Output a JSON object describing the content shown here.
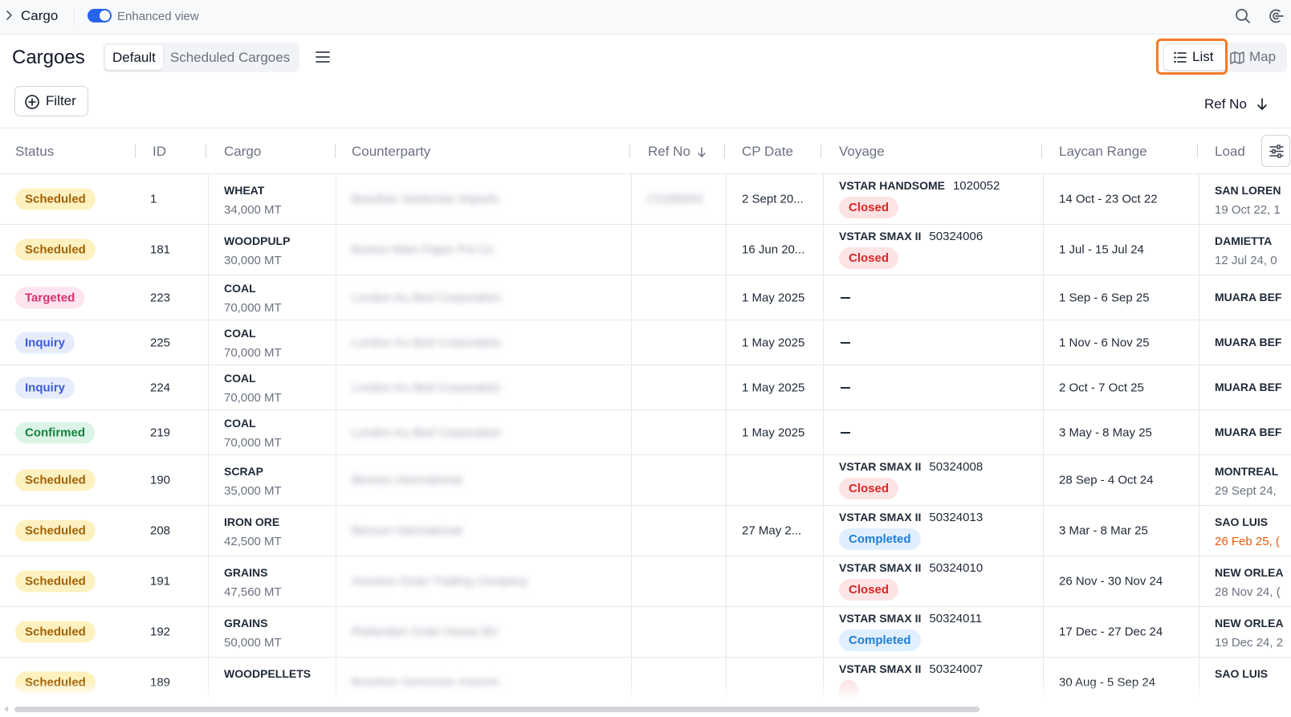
{
  "topbar": {
    "title": "Cargo",
    "enhanced_view_label": "Enhanced view",
    "enhanced_view_on": true
  },
  "header": {
    "page_title": "Cargoes",
    "tabs": [
      {
        "label": "Default",
        "active": true
      },
      {
        "label": "Scheduled Cargoes",
        "active": false
      }
    ],
    "view_list_label": "List",
    "view_map_label": "Map",
    "filter_label": "Filter",
    "sort_label": "Ref No"
  },
  "columns": [
    "Status",
    "ID",
    "Cargo",
    "Counterparty",
    "Ref No",
    "CP Date",
    "Voyage",
    "Laycan Range",
    "Load"
  ],
  "colors": {
    "accent": "#2563eb",
    "highlight": "#f37b26"
  },
  "rows": [
    {
      "status": "Scheduled",
      "status_kind": "scheduled",
      "id": "1",
      "cargo": "WHEAT",
      "qty": "34,000 MT",
      "counterparty": "Brazilian Santonian Imports",
      "ref_no": "CS180001",
      "cp_date": "2 Sept 20...",
      "voyage": "VSTAR HANDSOME",
      "voyage_no": "1020052",
      "voyage_status": "Closed",
      "voyage_kind": "closed",
      "laycan": "14 Oct - 23 Oct 22",
      "load_port": "SAN LOREN",
      "load_date": "19 Oct 22, 1",
      "load_late": false
    },
    {
      "status": "Scheduled",
      "status_kind": "scheduled",
      "id": "181",
      "cargo": "WOODPULP",
      "qty": "30,000 MT",
      "counterparty": "Boston Main Paper Pvt Co",
      "ref_no": "",
      "cp_date": "16 Jun 20...",
      "voyage": "VSTAR SMAX II",
      "voyage_no": "50324006",
      "voyage_status": "Closed",
      "voyage_kind": "closed",
      "laycan": "1 Jul - 15 Jul 24",
      "load_port": "DAMIETTA",
      "load_date": "12 Jul 24, 0",
      "load_late": false
    },
    {
      "status": "Targeted",
      "status_kind": "targeted",
      "id": "223",
      "cargo": "COAL",
      "qty": "70,000 MT",
      "counterparty": "London Ku Bed Corporation",
      "ref_no": "",
      "cp_date": "1 May 2025",
      "voyage": "",
      "voyage_no": "",
      "voyage_status": "",
      "voyage_kind": "",
      "laycan": "1 Sep - 6 Sep 25",
      "load_port": "MUARA BEF",
      "load_date": "",
      "load_late": false
    },
    {
      "status": "Inquiry",
      "status_kind": "inquiry",
      "id": "225",
      "cargo": "COAL",
      "qty": "70,000 MT",
      "counterparty": "London Ku Bed Corporation",
      "ref_no": "",
      "cp_date": "1 May 2025",
      "voyage": "",
      "voyage_no": "",
      "voyage_status": "",
      "voyage_kind": "",
      "laycan": "1 Nov - 6 Nov 25",
      "load_port": "MUARA BEF",
      "load_date": "",
      "load_late": false
    },
    {
      "status": "Inquiry",
      "status_kind": "inquiry",
      "id": "224",
      "cargo": "COAL",
      "qty": "70,000 MT",
      "counterparty": "London Ku Bed Corporation",
      "ref_no": "",
      "cp_date": "1 May 2025",
      "voyage": "",
      "voyage_no": "",
      "voyage_status": "",
      "voyage_kind": "",
      "laycan": "2 Oct - 7 Oct 25",
      "load_port": "MUARA BEF",
      "load_date": "",
      "load_late": false
    },
    {
      "status": "Confirmed",
      "status_kind": "confirmed",
      "id": "219",
      "cargo": "COAL",
      "qty": "70,000 MT",
      "counterparty": "London Ku Bed Corporation",
      "ref_no": "",
      "cp_date": "1 May 2025",
      "voyage": "",
      "voyage_no": "",
      "voyage_status": "",
      "voyage_kind": "",
      "laycan": "3 May - 8 May 25",
      "load_port": "MUARA BEF",
      "load_date": "",
      "load_late": false
    },
    {
      "status": "Scheduled",
      "status_kind": "scheduled",
      "id": "190",
      "cargo": "SCRAP",
      "qty": "35,000 MT",
      "counterparty": "Benson International",
      "ref_no": "",
      "cp_date": "",
      "voyage": "VSTAR SMAX II",
      "voyage_no": "50324008",
      "voyage_status": "Closed",
      "voyage_kind": "closed",
      "laycan": "28 Sep - 4 Oct 24",
      "load_port": "MONTREAL",
      "load_date": "29 Sept 24,",
      "load_late": false
    },
    {
      "status": "Scheduled",
      "status_kind": "scheduled",
      "id": "208",
      "cargo": "IRON ORE",
      "qty": "42,500 MT",
      "counterparty": "Benson International",
      "ref_no": "",
      "cp_date": "27 May 2...",
      "voyage": "VSTAR SMAX II",
      "voyage_no": "50324013",
      "voyage_status": "Completed",
      "voyage_kind": "completed",
      "laycan": "3 Mar - 8 Mar 25",
      "load_port": "SAO LUIS",
      "load_date": "26 Feb 25, (",
      "load_late": true
    },
    {
      "status": "Scheduled",
      "status_kind": "scheduled",
      "id": "191",
      "cargo": "GRAINS",
      "qty": "47,560 MT",
      "counterparty": "Houston Grain Trading Company",
      "ref_no": "",
      "cp_date": "",
      "voyage": "VSTAR SMAX II",
      "voyage_no": "50324010",
      "voyage_status": "Closed",
      "voyage_kind": "closed",
      "laycan": "26 Nov - 30 Nov 24",
      "load_port": "NEW ORLEA",
      "load_date": "28 Nov 24, (",
      "load_late": false
    },
    {
      "status": "Scheduled",
      "status_kind": "scheduled",
      "id": "192",
      "cargo": "GRAINS",
      "qty": "50,000 MT",
      "counterparty": "Rotterdam Grain House BV",
      "ref_no": "",
      "cp_date": "",
      "voyage": "VSTAR SMAX II",
      "voyage_no": "50324011",
      "voyage_status": "Completed",
      "voyage_kind": "completed",
      "laycan": "17 Dec - 27 Dec 24",
      "load_port": "NEW ORLEA",
      "load_date": "19 Dec 24, 2",
      "load_late": false
    },
    {
      "status": "Scheduled",
      "status_kind": "scheduled",
      "id": "189",
      "cargo": "WOODPELLETS",
      "qty": "",
      "counterparty": "Brazilian Santonian Imports",
      "ref_no": "",
      "cp_date": "",
      "voyage": "VSTAR SMAX II",
      "voyage_no": "50324007",
      "voyage_status": "",
      "voyage_kind": "closed",
      "laycan": "30 Aug - 5 Sep 24",
      "load_port": "SAO LUIS",
      "load_date": "",
      "load_late": false
    }
  ]
}
